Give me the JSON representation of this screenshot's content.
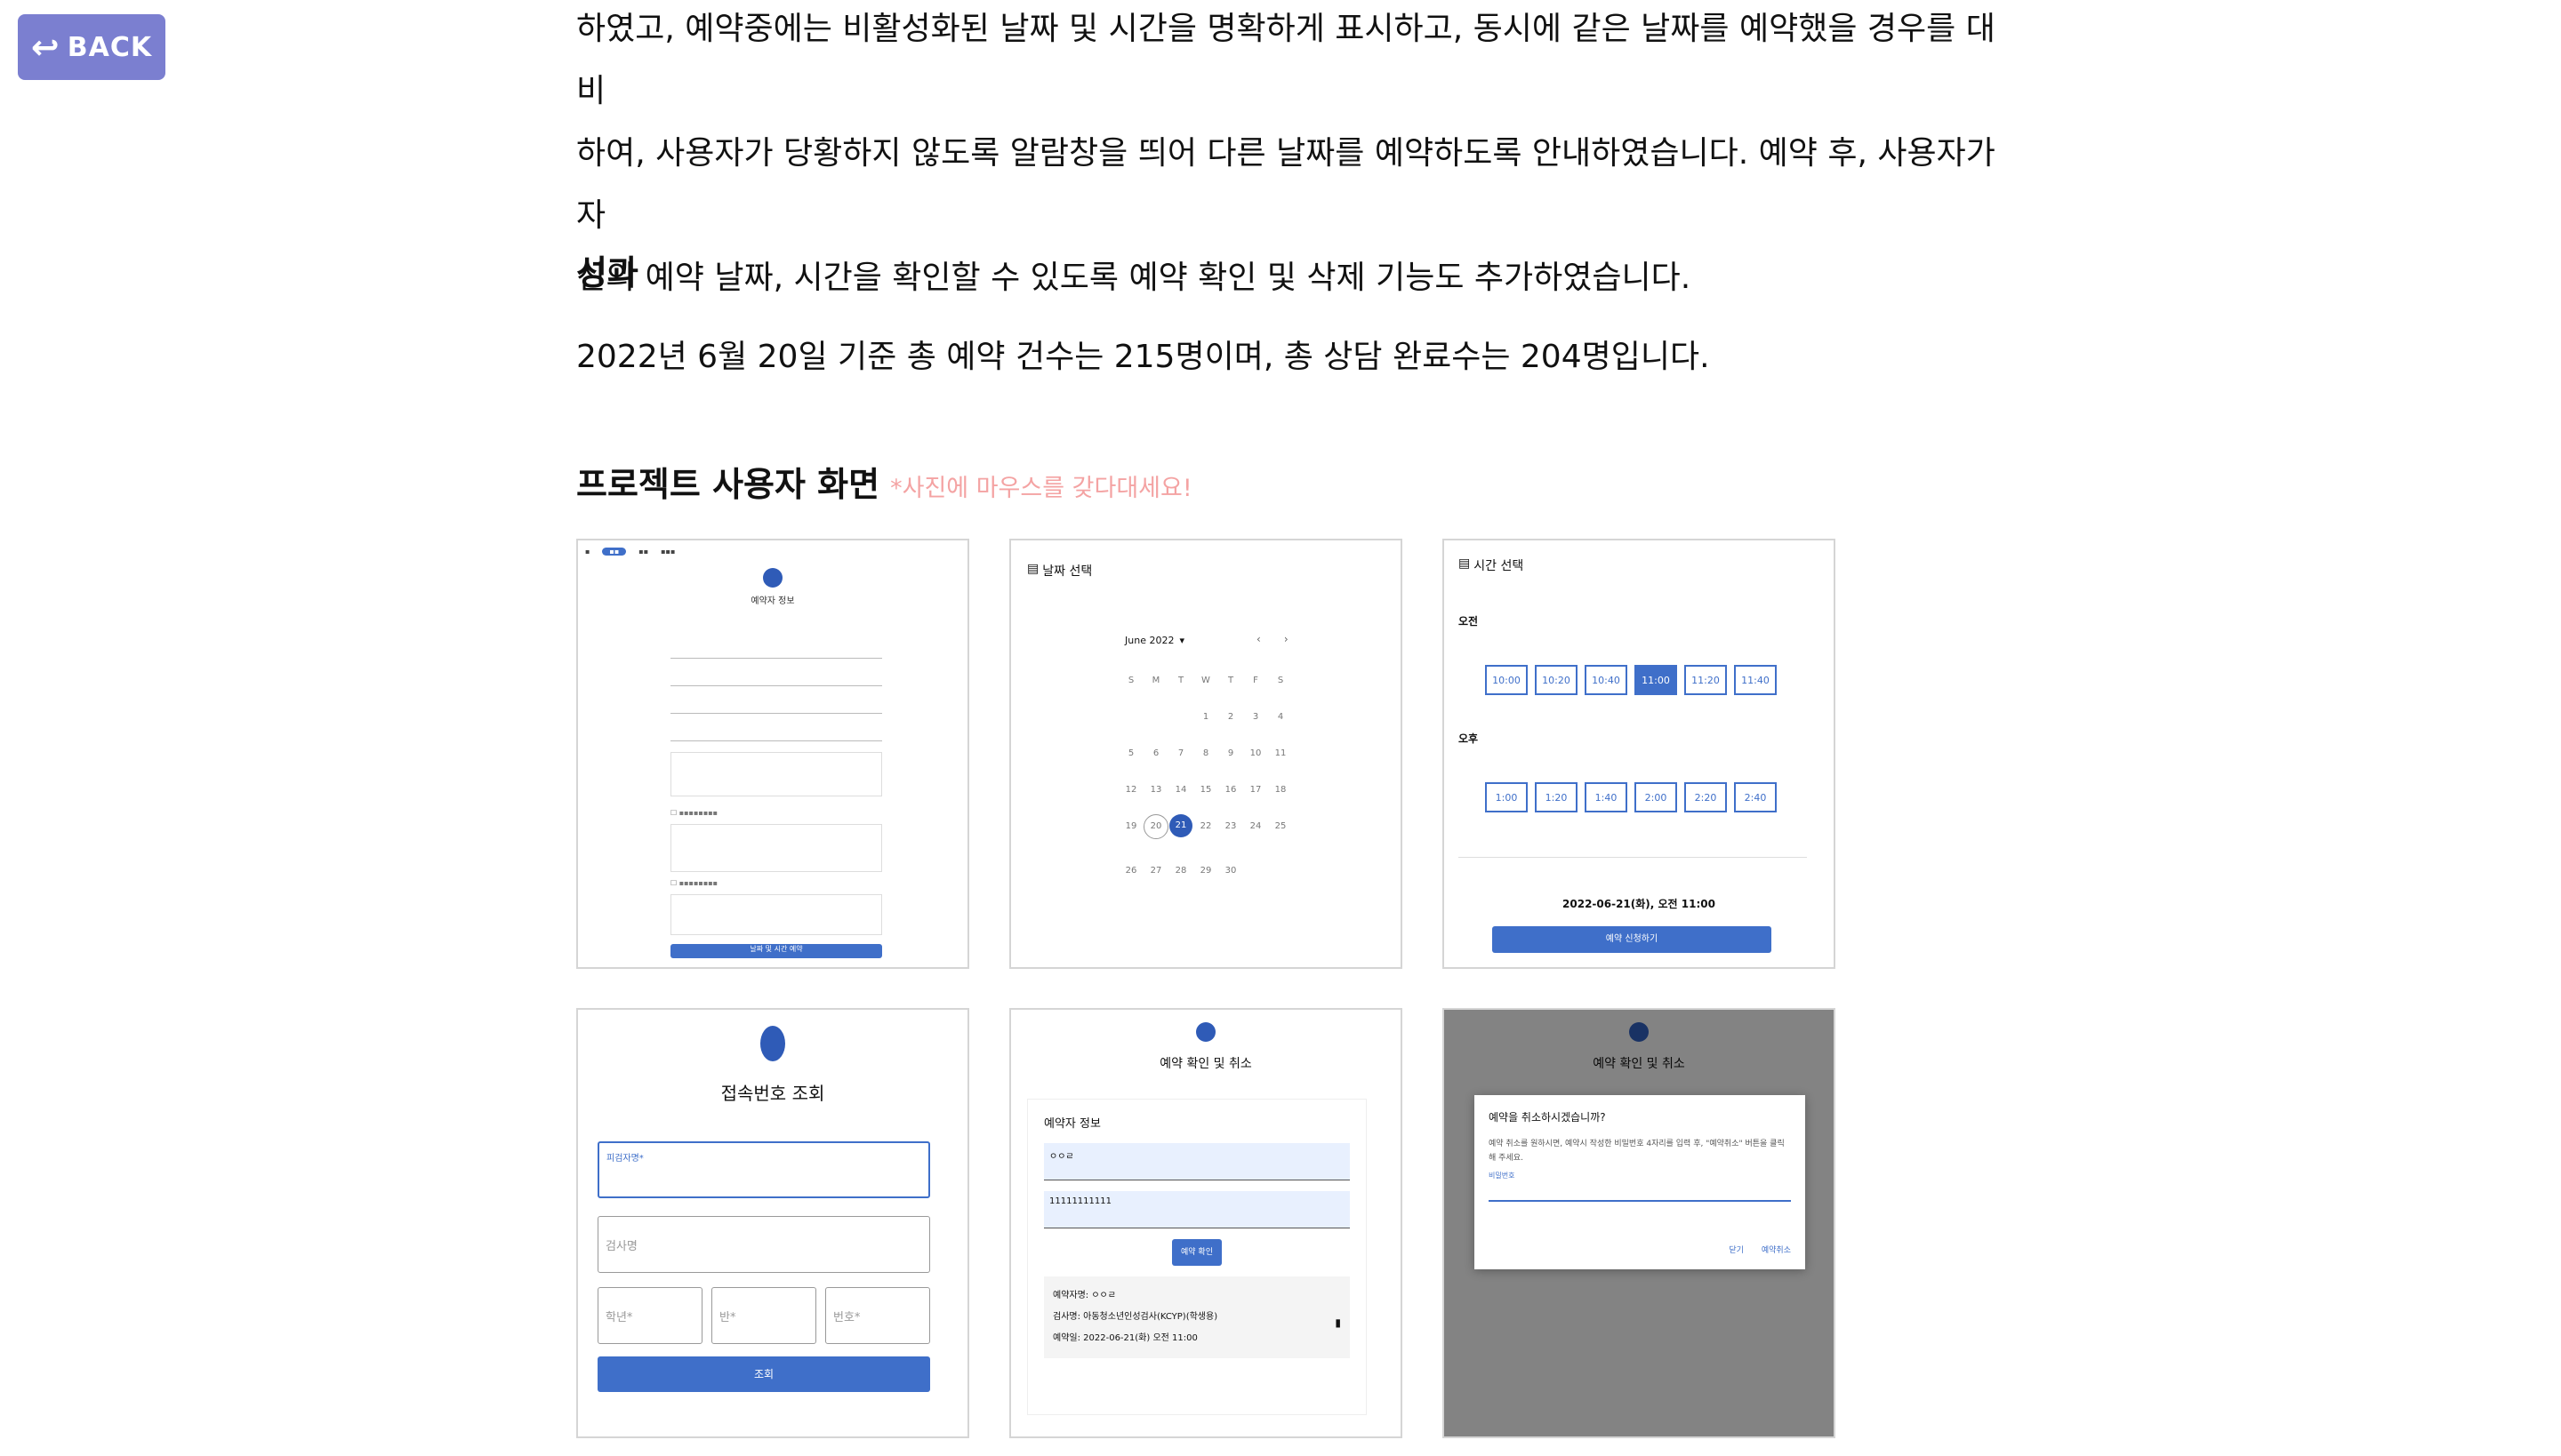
{
  "nav": {
    "back_label": "BACK"
  },
  "intro": {
    "line1": "하였고, 예약중에는 비활성화된 날짜 및 시간을 명확하게 표시하고, 동시에 같은 날짜를 예약했을 경우를 대비",
    "line2": "하여, 사용자가 당황하지 않도록 알람창을 띄어 다른 날짜를 예약하도록 안내하였습니다. 예약 후, 사용자가 자",
    "line3": "신의 예약 날짜, 시간을 확인할 수 있도록 예약 확인 및 삭제 기능도 추가하였습니다."
  },
  "result": {
    "heading": "성과",
    "text": "2022년 6월 20일 기준 총 예약 건수는 215명이며, 총 상담 완료수는 204명입니다."
  },
  "screens": {
    "heading": "프로젝트 사용자 화면",
    "hint": "*사진에 마우스를 갖다대세요!",
    "thumb1": {
      "title": "예약자 정보",
      "submit": "날짜 및 시간 예약"
    },
    "thumb2": {
      "title": "날짜 선택",
      "month": "June 2022",
      "weekdays": [
        "S",
        "M",
        "T",
        "W",
        "T",
        "F",
        "S"
      ],
      "days": [
        "",
        "",
        "",
        "1",
        "2",
        "3",
        "4",
        "5",
        "6",
        "7",
        "8",
        "9",
        "10",
        "11",
        "12",
        "13",
        "14",
        "15",
        "16",
        "17",
        "18",
        "19",
        "20",
        "21",
        "22",
        "23",
        "24",
        "25",
        "26",
        "27",
        "28",
        "29",
        "30",
        "",
        ""
      ]
    },
    "thumb3": {
      "title": "시간 선택",
      "am_label": "오전",
      "am_times": [
        "10:00",
        "10:20",
        "10:40",
        "11:00",
        "11:20",
        "11:40"
      ],
      "pm_label": "오후",
      "pm_times": [
        "1:00",
        "1:20",
        "1:40",
        "2:00",
        "2:20",
        "2:40"
      ],
      "selected_datetime": "2022-06-21(화), 오전 11:00",
      "submit": "예약 신청하기"
    },
    "thumb4": {
      "title": "접속번호 조회",
      "field1": "피검자명*",
      "field2": "검사명",
      "field3": "학년*",
      "field4": "반*",
      "field5": "번호*",
      "submit": "조회"
    },
    "thumb5": {
      "title": "예약 확인 및 취소",
      "section": "예약자 정보",
      "name_value": "ㅇㅇㄹ",
      "phone_value": "11111111111",
      "confirm": "예약 확인",
      "info1": "예약자명: ㅇㅇㄹ",
      "info2": "검사명: 아동청소년인성검사(KCYP)(학생용)",
      "info3": "예약일: 2022-06-21(화) 오전 11:00"
    },
    "thumb6": {
      "title": "예약 확인 및 취소",
      "dialog_title": "예약을 취소하시겠습니까?",
      "dialog_text": "예약 취소를 원하시면, 예약시 작성한 비밀번호 4자리를 입력 후, \"예약취소\" 버튼을 클릭해 주세요.",
      "dialog_field": "비밀번호",
      "close": "닫기",
      "cancel": "예약취소"
    }
  }
}
